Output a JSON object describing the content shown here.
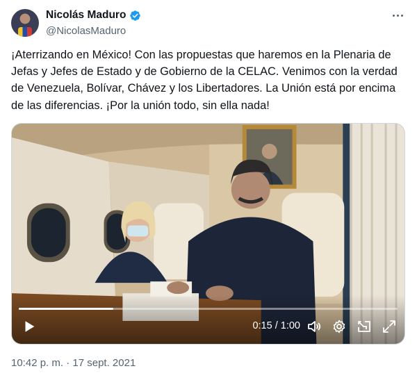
{
  "author": {
    "name": "Nicolás Maduro",
    "handle": "@NicolasMaduro",
    "verified": true
  },
  "tweet": {
    "text": "¡Aterrizando en México! Con las propuestas que haremos en la Plenaria de Jefas y Jefes de Estado y de Gobierno de la CELAC. Venimos con la verdad de Venezuela, Bolívar, Chávez y los Libertadores. La Unión está por encima de las diferencias. ¡Por la unión todo, sin ella nada!",
    "timestamp": "10:42 p. m. · 17 sept. 2021"
  },
  "video": {
    "time_display": "0:15 / 1:00",
    "progress_fraction": 0.25
  },
  "icons": {
    "verified": "verified-badge-icon",
    "more": "more-dots-icon",
    "play": "play-icon",
    "volume": "volume-icon",
    "settings": "gear-icon",
    "pip": "popout-icon",
    "fullscreen": "fullscreen-icon"
  },
  "colors": {
    "text": "#0f1419",
    "secondary": "#536471",
    "verified": "#1d9bf0"
  }
}
